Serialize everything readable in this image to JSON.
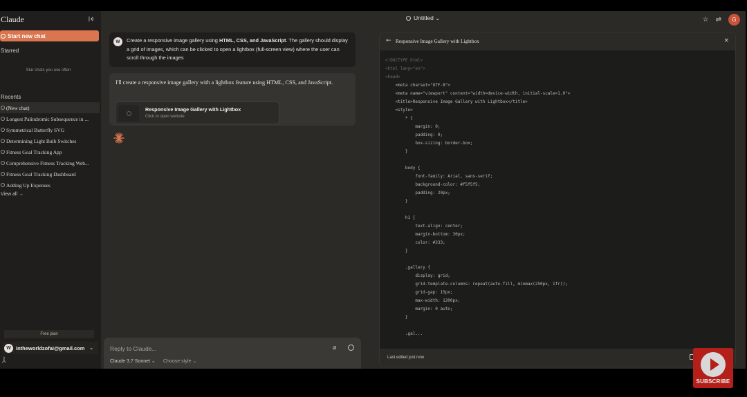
{
  "sidebar": {
    "brand": "Claude",
    "new_chat_label": "Start new chat",
    "starred_label": "Starred",
    "starred_empty": "Star chats you use often",
    "recents_label": "Recents",
    "recents": [
      {
        "label": "(New chat)"
      },
      {
        "label": "Longest Palindromic Subsequence in ..."
      },
      {
        "label": "Symmetrical Butterfly SVG"
      },
      {
        "label": "Determining Light Bulb Switches"
      },
      {
        "label": "Fitness Goal Tracking App"
      },
      {
        "label": "Comprehensive Fitness Tracking Web..."
      },
      {
        "label": "Fitness Goal Tracking Dashboard"
      },
      {
        "label": "Adding Up Expenses"
      }
    ],
    "view_all": "View all →",
    "plan": "Free plan",
    "account_email": "intheworldzofai@gmail.com",
    "account_initial": "W",
    "bottom_glyph": "Aͣ"
  },
  "topbar": {
    "title": "Untitled ⌄",
    "avatar_initial": "G"
  },
  "chat": {
    "user_initial": "W",
    "user_message_parts": [
      "Create a responsive image gallery using ",
      "HTML, CSS, and JavaScript",
      ". The gallery should display a grid of images, which can be clicked to open a lightbox (full-screen view) where the user can scroll through the images"
    ],
    "assistant_message": "I'll create a responsive image gallery with a lightbox feature using HTML, CSS, and JavaScript.",
    "artifact_title": "Responsive Image Gallery with Lightbox",
    "artifact_subtitle": "Click to open website"
  },
  "composer": {
    "placeholder": "Reply to Claude...",
    "model": "Claude 3.7 Sonnet ⌄",
    "style": "Choose style ⌄"
  },
  "artifact_panel": {
    "title": "Responsive Image Gallery with Lightbox",
    "code_lines": [
      "<!DOCTYPE html>",
      "<html lang=\"en\">",
      "<head>",
      "    <meta charset=\"UTF-8\">",
      "    <meta name=\"viewport\" content=\"width=device-width, initial-scale=1.0\">",
      "    <title>Responsive Image Gallery with Lightbox</title>",
      "    <style>",
      "        * {",
      "            margin: 0;",
      "            padding: 0;",
      "            box-sizing: border-box;",
      "        }",
      "",
      "        body {",
      "            font-family: Arial, sans-serif;",
      "            background-color: #f5f5f5;",
      "            padding: 20px;",
      "        }",
      "",
      "        h1 {",
      "            text-align: center;",
      "            margin-bottom: 30px;",
      "            color: #333;",
      "        }",
      "",
      "        .gallery {",
      "            display: grid;",
      "            grid-template-columns: repeat(auto-fill, minmax(250px, 1fr));",
      "            grid-gap: 15px;",
      "            max-width: 1200px;",
      "            margin: 0 auto;",
      "        }",
      "",
      "        .gal..."
    ],
    "footer_text": "Last edited just now"
  },
  "overlay": {
    "subscribe_label": "SUBSCRIBE"
  }
}
